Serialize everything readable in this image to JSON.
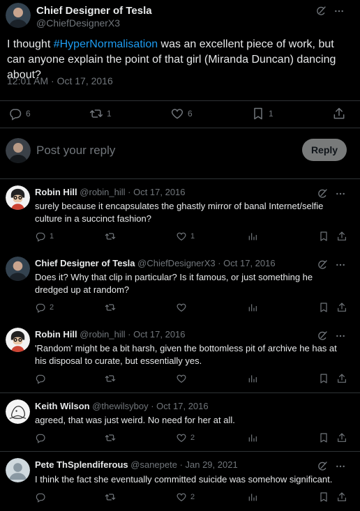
{
  "main_tweet": {
    "author_name": "Chief Designer of Tesla",
    "author_handle": "@ChiefDesignerX3",
    "text_before": "I thought ",
    "hashtag": "#HyperNormalisation",
    "text_after": " was an excellent piece of work, but can anyone explain the point of that girl (Miranda Duncan) dancing about?",
    "timestamp": "12:01 AM · Oct 17, 2016",
    "replies_count": "6",
    "likes_count": "6",
    "bookmarks_count": "1"
  },
  "composer": {
    "placeholder": "Post your reply",
    "reply_button": "Reply"
  },
  "replies": [
    {
      "name": "Robin Hill",
      "handle": "@robin_hill · Oct 17, 2016",
      "text": "surely because it encapsulates the ghastly mirror of banal Internet/selfie culture in a succinct fashion?",
      "replies": "1",
      "retweets": "",
      "likes": "1"
    },
    {
      "name": "Chief Designer of Tesla",
      "handle": "@ChiefDesignerX3 · Oct 17, 2016",
      "text": "Does it? Why that clip in particular? Is it famous, or just something he dredged up at random?",
      "replies": "2",
      "retweets": "",
      "likes": ""
    },
    {
      "name": "Robin Hill",
      "handle": "@robin_hill · Oct 17, 2016",
      "text": "'Random' might be a bit harsh, given the bottomless pit of archive he has at his disposal to curate, but essentially yes.",
      "replies": "",
      "retweets": "",
      "likes": ""
    },
    {
      "name": "Keith Wilson",
      "handle": "@thewilsyboy · Oct 17, 2016",
      "text": "agreed, that was just weird. No need for her at all.",
      "replies": "",
      "retweets": "",
      "likes": "2"
    },
    {
      "name": "Pete ThSplendiferous",
      "handle": "@sanepete · Jan 29, 2021",
      "text": "I think the fact she eventually committed suicide was somehow significant.",
      "replies": "",
      "retweets": "",
      "likes": "2"
    }
  ],
  "colors": {
    "background": "#000000",
    "text": "#e7e9ea",
    "muted": "#71767b",
    "link": "#1d9bf0",
    "divider": "#2f3336"
  },
  "icons": [
    "grok-icon",
    "more-icon",
    "reply-icon",
    "retweet-icon",
    "like-icon",
    "bookmark-icon",
    "share-icon",
    "views-icon"
  ]
}
